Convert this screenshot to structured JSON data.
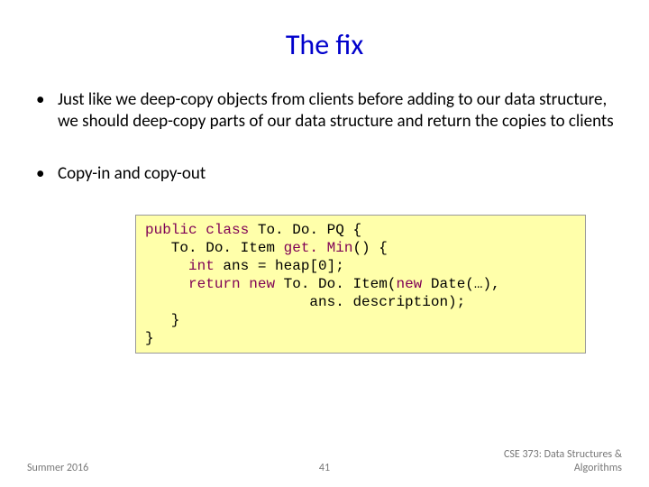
{
  "title": "The fix",
  "bullets": [
    "Just like we deep-copy objects from clients before adding to our data structure, we should deep-copy parts of our data structure and return the copies to clients",
    "Copy-in and copy-out"
  ],
  "code": {
    "kw_public": "public",
    "kw_class": "class",
    "cls": " To. Do. PQ {",
    "line2a": "   To. Do. Item ",
    "method": "get. Min",
    "line2b": "() {",
    "kw_int": "int",
    "line3": " ans = heap[0];",
    "kw_return": "return",
    "kw_new1": "new",
    "line4a": " To. Do. Item(",
    "kw_new2": "new",
    "line4b": " Date(…),",
    "line5": "                   ans. description);",
    "line6": "   }",
    "line7": "}"
  },
  "footer": {
    "left": "Summer 2016",
    "center": "41",
    "right_line1": "CSE 373: Data Structures &",
    "right_line2": "Algorithms"
  }
}
